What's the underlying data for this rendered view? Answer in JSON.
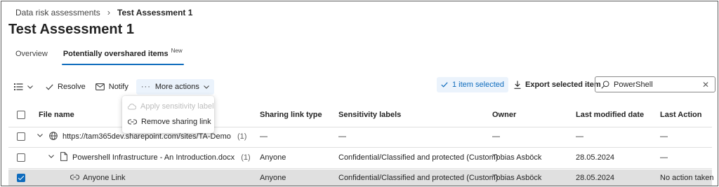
{
  "breadcrumb": {
    "parent": "Data risk assessments",
    "current": "Test Assessment 1"
  },
  "page": {
    "title": "Test Assessment 1"
  },
  "tabs": [
    {
      "label": "Overview",
      "active": false
    },
    {
      "label": "Potentially overshared items",
      "badge": "New",
      "active": true
    }
  ],
  "toolbar": {
    "resolve": "Resolve",
    "notify": "Notify",
    "more_actions": "More actions",
    "selected": "1 item selected",
    "export": "Export selected item"
  },
  "search": {
    "value": "PowerShell"
  },
  "dropdown": {
    "items": [
      {
        "label": "Apply sensitivity label",
        "disabled": true,
        "icon": "cloud-tag-icon"
      },
      {
        "label": "Remove sharing link",
        "disabled": false,
        "icon": "link-remove-icon"
      }
    ]
  },
  "table": {
    "columns": [
      "File name",
      "Sharing link type",
      "Sensitivity labels",
      "Owner",
      "Last modified date",
      "Last Action"
    ],
    "rows": [
      {
        "name": "https://tam365dev.sharepoint.com/sites/TA-Demo",
        "count": "(1)",
        "link_type": "—",
        "label": "—",
        "owner": "—",
        "modified": "—",
        "action": "—",
        "selected": false
      },
      {
        "name": "Powershell Infrastructure - An Introduction.docx",
        "count": "(1)",
        "link_type": "Anyone",
        "label": "Confidential/Classified and protected (Custom)",
        "owner": "Tobias Asböck",
        "modified": "28.05.2024",
        "action": "—",
        "selected": false
      },
      {
        "name": "Anyone Link",
        "count": "",
        "link_type": "Anyone",
        "label": "Confidential/Classified and protected (Custom)",
        "owner": "Tobias Asböck",
        "modified": "28.05.2024",
        "action": "No action taken",
        "selected": true
      }
    ]
  },
  "colors": {
    "accent": "#0f6cbd",
    "selected_pill_bg": "#ebf3fc",
    "selected_row_bg": "#e0e0e0"
  }
}
